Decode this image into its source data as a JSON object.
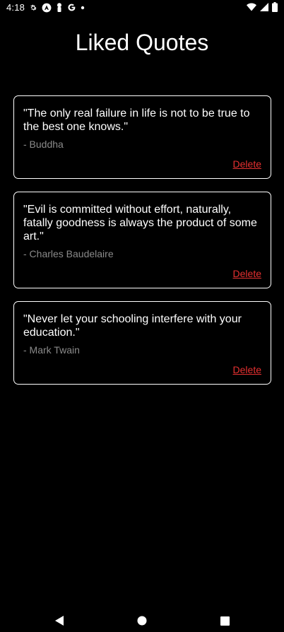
{
  "status_bar": {
    "time": "4:18",
    "left_icons": [
      "gear-icon",
      "android-app-icon",
      "person-icon",
      "google-g-icon",
      "dot-icon"
    ],
    "right_icons": [
      "wifi-icon",
      "signal-icon",
      "battery-icon"
    ]
  },
  "page": {
    "title": "Liked Quotes"
  },
  "quotes": [
    {
      "text": "\"The only real failure in life is not to be true to the best one knows.\"",
      "author": "- Buddha",
      "delete_label": "Delete"
    },
    {
      "text": "\"Evil is committed without effort, naturally, fatally goodness is always the product of some art.\"",
      "author": "- Charles Baudelaire",
      "delete_label": "Delete"
    },
    {
      "text": "\"Never let your schooling interfere with your education.\"",
      "author": "- Mark Twain",
      "delete_label": "Delete"
    }
  ],
  "colors": {
    "background": "#000000",
    "text": "#ffffff",
    "author": "#8a8a8a",
    "delete": "#e53030"
  },
  "nav_bar": {
    "icons": [
      "back-icon",
      "home-icon",
      "recents-icon"
    ]
  }
}
